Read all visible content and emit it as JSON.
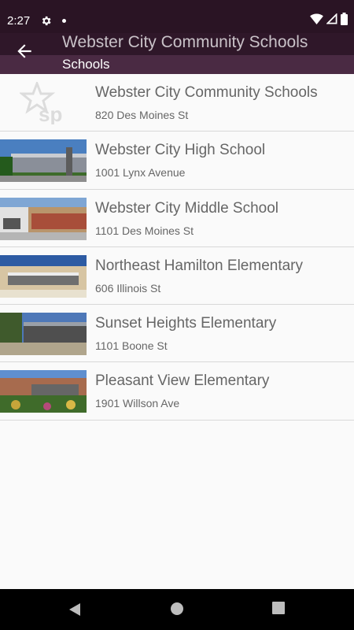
{
  "status_bar": {
    "time": "2:27",
    "icons": [
      "gear-icon",
      "notification-dot-icon",
      "wifi-icon",
      "signal-icon",
      "battery-icon"
    ]
  },
  "app_bar": {
    "title": "Webster City Community Schools",
    "subtitle": "Schools",
    "back_icon": "arrow-left-icon"
  },
  "schools": [
    {
      "name": "Webster City Community Schools",
      "address": "820 Des Moines St",
      "image": "sp-logo"
    },
    {
      "name": "Webster City High School",
      "address": "1001 Lynx Avenue",
      "image": "photo"
    },
    {
      "name": "Webster City Middle School",
      "address": "1101 Des Moines St",
      "image": "photo"
    },
    {
      "name": "Northeast Hamilton Elementary",
      "address": "606 Illinois St",
      "image": "photo"
    },
    {
      "name": "Sunset Heights Elementary",
      "address": "1101 Boone St",
      "image": "photo"
    },
    {
      "name": "Pleasant View Elementary",
      "address": "1901 Willson Ave",
      "image": "photo"
    }
  ],
  "nav_bar": {
    "icons": [
      "back-triangle-icon",
      "home-circle-icon",
      "recents-square-icon"
    ]
  },
  "colors": {
    "status_bar": "#2a1424",
    "app_bar": "#2f1729",
    "subbar": "#4a2a43",
    "list_background": "#fafafa",
    "text": "#666666"
  }
}
